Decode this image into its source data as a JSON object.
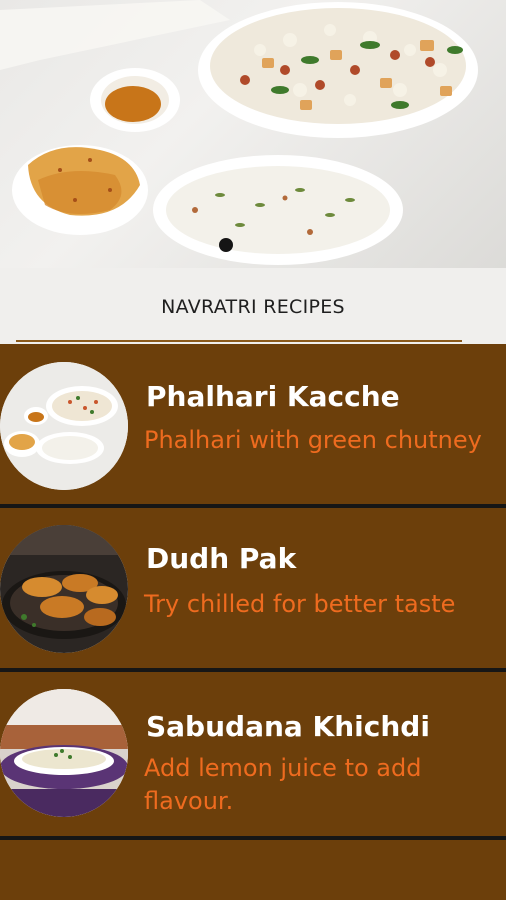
{
  "header": {
    "title": "NAVRATRI RECIPES"
  },
  "carousel": {
    "active_index": 0
  },
  "recipes": [
    {
      "title": "Phalhari Kacche",
      "subtitle": "Phalhari with green chutney"
    },
    {
      "title": "Dudh Pak",
      "subtitle": "Try chilled for better taste"
    },
    {
      "title": "Sabudana Khichdi",
      "subtitle": "Add lemon juice to add flavour."
    }
  ],
  "colors": {
    "list_background": "#6c3f0b",
    "separator": "#161616",
    "title_bar": "#f0efed",
    "recipe_title": "#ffffff",
    "recipe_subtitle": "#ee6b1f"
  }
}
